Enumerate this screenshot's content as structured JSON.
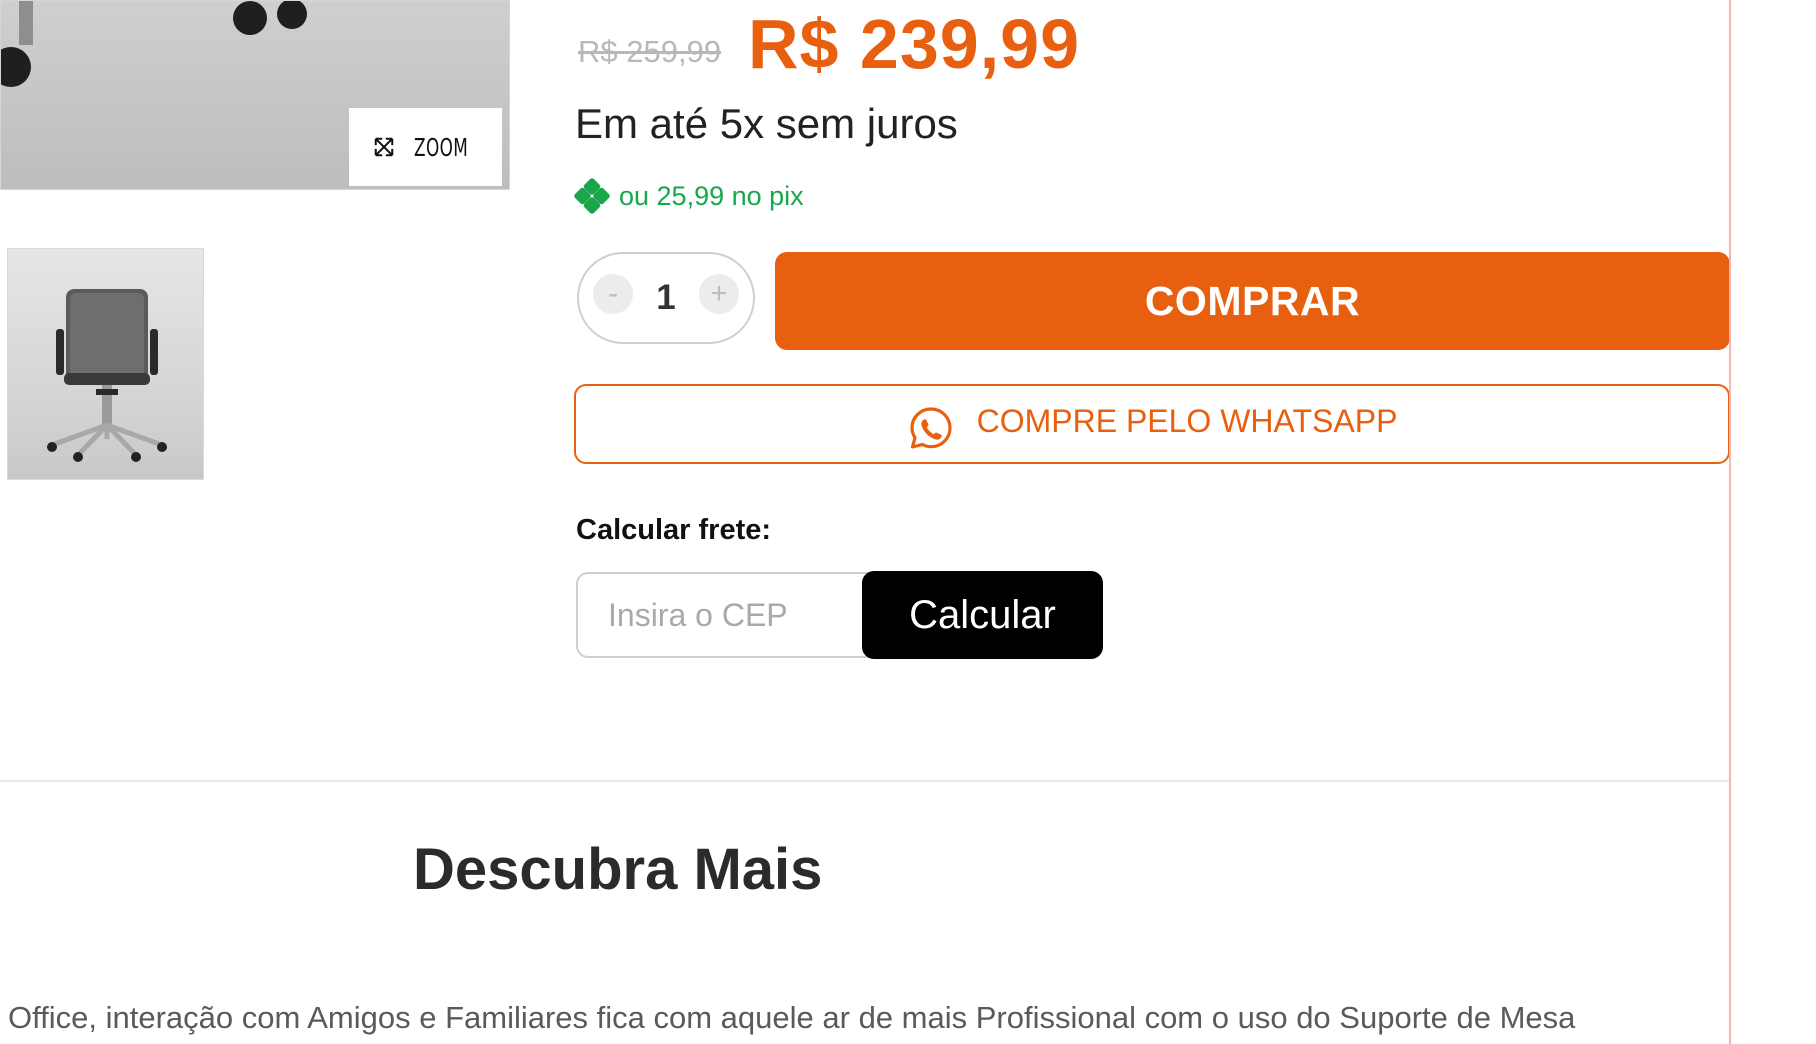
{
  "gallery": {
    "zoom_label": "ZOOM"
  },
  "price": {
    "old": "R$ 259,99",
    "current": "R$ 239,99",
    "installments": "Em até 5x sem juros",
    "pix": "ou 25,99 no pix"
  },
  "quantity": {
    "minus": "-",
    "value": "1",
    "plus": "+"
  },
  "actions": {
    "buy_label": "COMPRAR",
    "whatsapp_label": "COMPRE PELO WHATSAPP"
  },
  "shipping": {
    "label": "Calcular frete:",
    "placeholder": "Insira o CEP",
    "button_label": "Calcular"
  },
  "section": {
    "title": "Descubra Mais",
    "description": "Office, interação com Amigos e Familiares fica com aquele ar de mais Profissional com o uso do Suporte de Mesa"
  },
  "colors": {
    "accent": "#e8600f",
    "pix_green": "#1aa64b",
    "button_dark": "#000000"
  },
  "icons": {
    "zoom": "expand-arrows-icon",
    "pix": "pix-icon",
    "whatsapp": "whatsapp-icon"
  }
}
